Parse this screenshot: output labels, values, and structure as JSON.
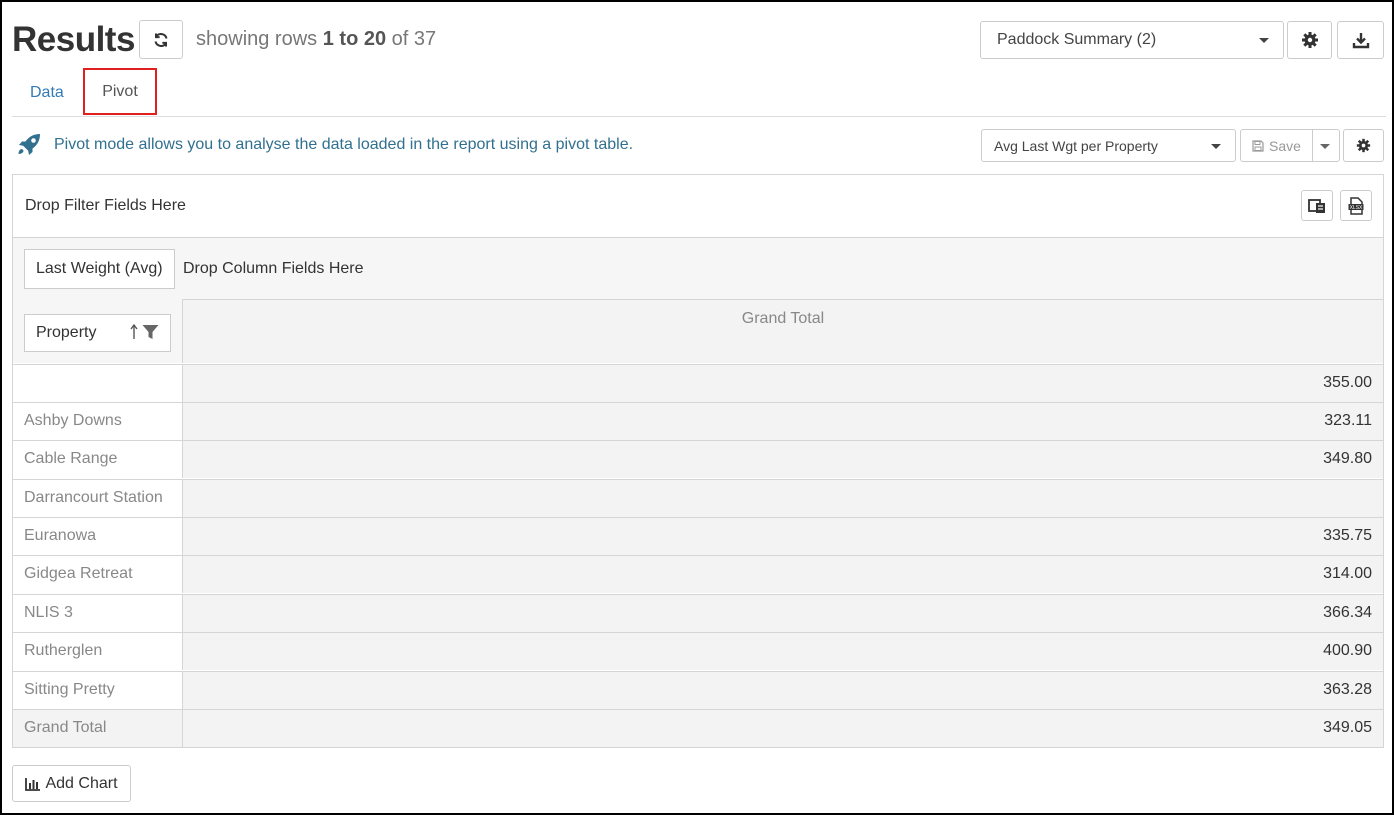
{
  "header": {
    "title": "Results",
    "rows_prefix": "showing rows",
    "rows_range": "1 to 20",
    "rows_of": "of 37"
  },
  "report_select": {
    "value": "Paddock Summary (2)"
  },
  "tabs": [
    {
      "label": "Data",
      "active": false
    },
    {
      "label": "Pivot",
      "active": true
    }
  ],
  "info": {
    "text": "Pivot mode allows you to analyse the data loaded in the report using a pivot table."
  },
  "pivot_select": {
    "value": "Avg Last Wgt per Property"
  },
  "save": {
    "label": "Save"
  },
  "pivot": {
    "filter_placeholder": "Drop Filter Fields Here",
    "value_field": "Last Weight (Avg)",
    "column_placeholder": "Drop Column Fields Here",
    "row_field": "Property",
    "column_header": "Grand Total",
    "rows": [
      {
        "label": "",
        "value": "355.00"
      },
      {
        "label": "Ashby Downs",
        "value": "323.11"
      },
      {
        "label": "Cable Range",
        "value": "349.80"
      },
      {
        "label": "Darrancourt Station",
        "value": ""
      },
      {
        "label": "Euranowa",
        "value": "335.75"
      },
      {
        "label": "Gidgea Retreat",
        "value": "314.00"
      },
      {
        "label": "NLIS 3",
        "value": "366.34"
      },
      {
        "label": "Rutherglen",
        "value": "400.90"
      },
      {
        "label": "Sitting Pretty",
        "value": "363.28"
      }
    ],
    "grand_total": {
      "label": "Grand Total",
      "value": "349.05"
    }
  },
  "add_chart": {
    "label": "Add Chart"
  },
  "icons": {
    "refresh": "refresh-icon",
    "settings": "gear-icon",
    "download": "download-icon",
    "rocket": "rocket-icon",
    "save": "floppy-icon",
    "sort": "sort-asc-icon",
    "filter": "filter-icon",
    "chart": "bar-chart-icon"
  },
  "colors": {
    "accent": "#337ab7",
    "info": "#31708f",
    "tab_highlight": "#e02020"
  }
}
